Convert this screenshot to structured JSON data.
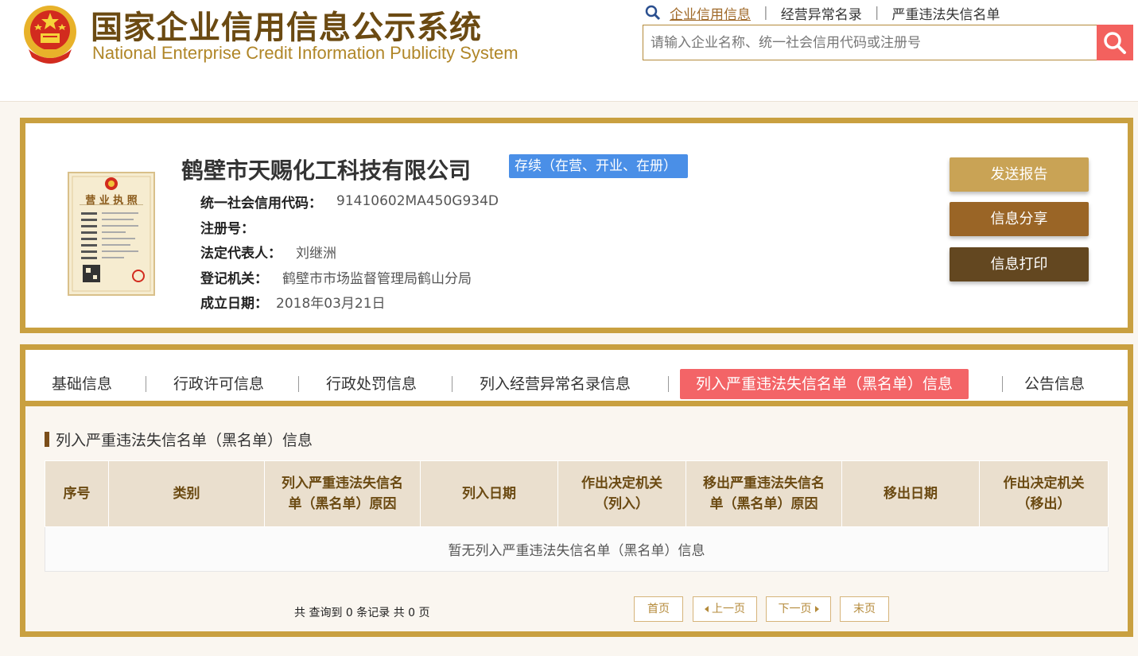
{
  "header": {
    "title_cn": "国家企业信用信息公示系统",
    "title_en": "National Enterprise Credit Information Publicity System",
    "nav_links": [
      {
        "label": "企业信用信息",
        "active": true
      },
      {
        "label": "经营异常名录",
        "active": false
      },
      {
        "label": "严重违法失信名单",
        "active": false
      }
    ],
    "separator": "|",
    "search_placeholder": "请输入企业名称、统一社会信用代码或注册号"
  },
  "company": {
    "name": "鹤壁市天赐化工科技有限公司",
    "status": "存续（在营、开业、在册）",
    "fields": [
      {
        "label": "统一社会信用代码：",
        "value": "91410602MA450G934D"
      },
      {
        "label": "注册号：",
        "value": ""
      },
      {
        "label": "法定代表人：",
        "value": "刘继洲"
      },
      {
        "label": "登记机关：",
        "value": "鹤壁市市场监督管理局鹤山分局"
      },
      {
        "label": "成立日期：",
        "value": "2018年03月21日"
      }
    ],
    "license_text": "营 业 执 照"
  },
  "actions": [
    {
      "label": "发送报告",
      "color": "#c9a355"
    },
    {
      "label": "信息分享",
      "color": "#9a6526"
    },
    {
      "label": "信息打印",
      "color": "#634720"
    }
  ],
  "tabs": [
    {
      "label": "基础信息",
      "active": false
    },
    {
      "label": "行政许可信息",
      "active": false
    },
    {
      "label": "行政处罚信息",
      "active": false
    },
    {
      "label": "列入经营异常名录信息",
      "active": false
    },
    {
      "label": "列入严重违法失信名单（黑名单）信息",
      "active": true
    },
    {
      "label": "公告信息",
      "active": false
    }
  ],
  "section": {
    "title": "列入严重违法失信名单（黑名单）信息",
    "columns": [
      {
        "line1": "序号",
        "line2": ""
      },
      {
        "line1": "类别",
        "line2": ""
      },
      {
        "line1": "列入严重违法失信名",
        "line2": "单（黑名单）原因"
      },
      {
        "line1": "列入日期",
        "line2": ""
      },
      {
        "line1": "作出决定机关",
        "line2": "（列入）"
      },
      {
        "line1": "移出严重违法失信名",
        "line2": "单（黑名单）原因"
      },
      {
        "line1": "移出日期",
        "line2": ""
      },
      {
        "line1": "作出决定机关",
        "line2": "（移出）"
      }
    ],
    "empty_message": "暂无列入严重违法失信名单（黑名单）信息"
  },
  "pagination": {
    "summary": "共 查询到 0 条记录 共 0 页",
    "first": "首页",
    "prev": "上一页",
    "next": "下一页",
    "last": "末页"
  },
  "colors": {
    "brand_gold": "#c9a040",
    "brand_brown": "#6b4a12",
    "accent_red": "#f36467",
    "status_blue": "#4a8fe7"
  }
}
